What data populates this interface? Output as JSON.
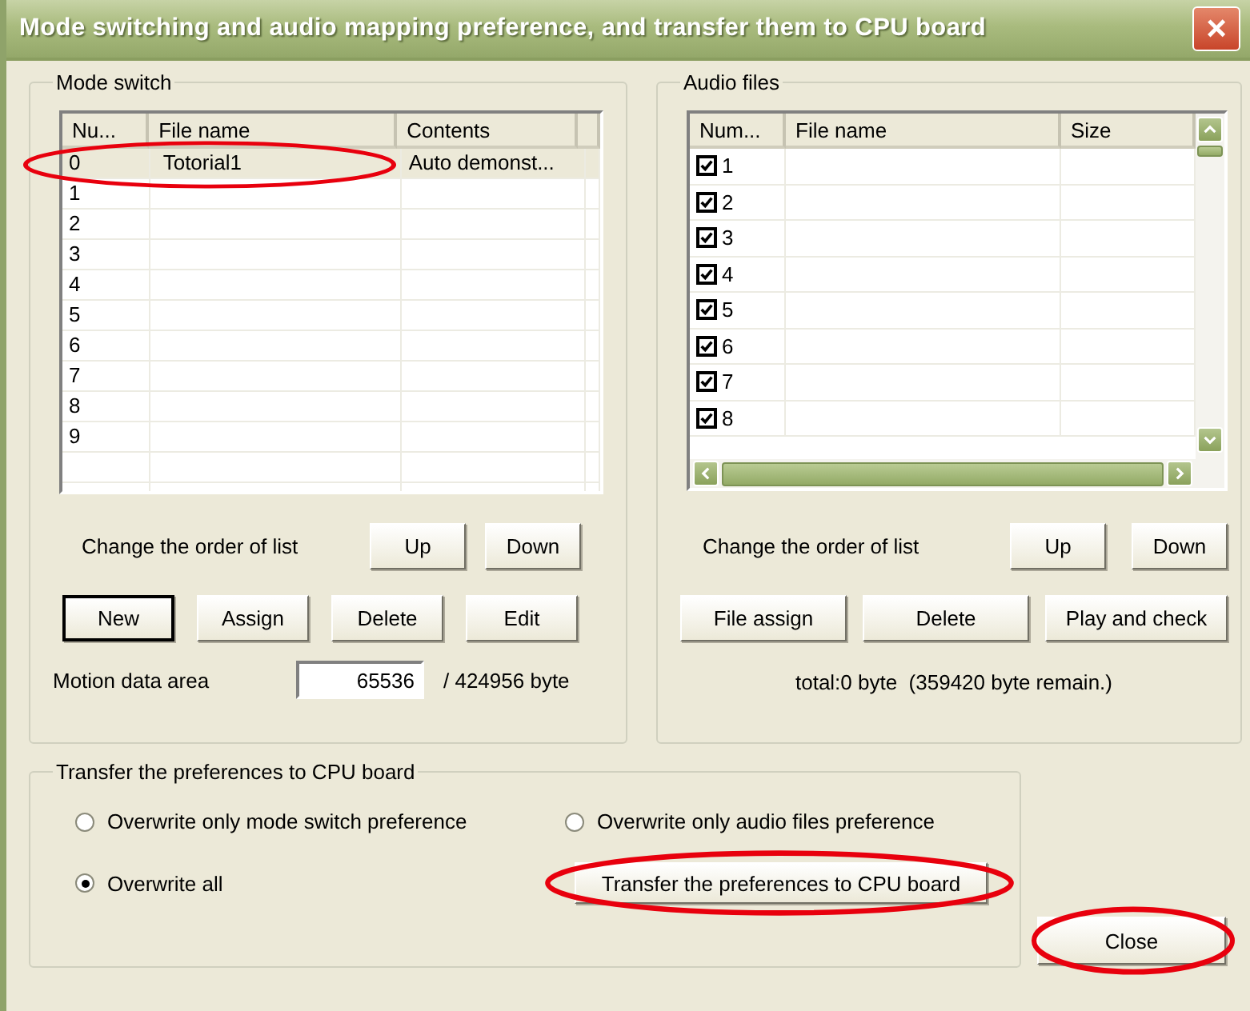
{
  "window": {
    "title": "Mode switching and audio mapping preference, and transfer them to CPU board",
    "close": "×"
  },
  "mode_switch": {
    "title": "Mode switch",
    "columns": [
      "Nu...",
      "File name",
      "Contents"
    ],
    "rows": [
      {
        "num": "0",
        "file_name": "Totorial1",
        "contents": "Auto demonst...",
        "selected": true,
        "circled": true
      },
      {
        "num": "1",
        "selected": false,
        "circled": false
      },
      {
        "num": "2",
        "selected": false,
        "circled": false
      },
      {
        "num": "3",
        "selected": false,
        "circled": false
      },
      {
        "num": "4",
        "selected": false,
        "circled": false
      },
      {
        "num": "5",
        "selected": false,
        "circled": false
      },
      {
        "num": "6",
        "selected": false,
        "circled": false
      },
      {
        "num": "7",
        "selected": false,
        "circled": false
      },
      {
        "num": "8",
        "selected": false,
        "circled": false
      },
      {
        "num": "9",
        "selected": false,
        "circled": false
      }
    ],
    "order_label": "Change the order of list",
    "up": "Up",
    "down": "Down",
    "buttons": [
      {
        "label": "New",
        "default": true
      },
      {
        "label": "Assign",
        "default": false
      },
      {
        "label": "Delete",
        "default": false
      },
      {
        "label": "Edit",
        "default": false
      }
    ],
    "motion_label": "Motion data area",
    "motion_value": "65536",
    "motion_total": "/ 424956 byte"
  },
  "audio_files": {
    "title": "Audio files",
    "columns": [
      "Num...",
      "File name",
      "Size"
    ],
    "rows": [
      {
        "num": "1",
        "checked": true
      },
      {
        "num": "2",
        "checked": true
      },
      {
        "num": "3",
        "checked": true
      },
      {
        "num": "4",
        "checked": true
      },
      {
        "num": "5",
        "checked": true
      },
      {
        "num": "6",
        "checked": true
      },
      {
        "num": "7",
        "checked": true
      },
      {
        "num": "8",
        "checked": true
      }
    ],
    "order_label": "Change the order of list",
    "up": "Up",
    "down": "Down",
    "buttons": [
      {
        "label": "File assign"
      },
      {
        "label": "Delete"
      },
      {
        "label": "Play and check"
      }
    ],
    "total": "total:0 byte  (359420 byte remain.)"
  },
  "transfer": {
    "title": "Transfer the preferences to CPU board",
    "options": [
      {
        "label": "Overwrite only mode switch preference",
        "selected": false
      },
      {
        "label": "Overwrite only audio files preference",
        "selected": false
      },
      {
        "label": "Overwrite all",
        "selected": true
      }
    ],
    "button": {
      "label": "Transfer the preferences to CPU board",
      "circled": true
    }
  },
  "close_button": {
    "label": "Close",
    "circled": true
  }
}
